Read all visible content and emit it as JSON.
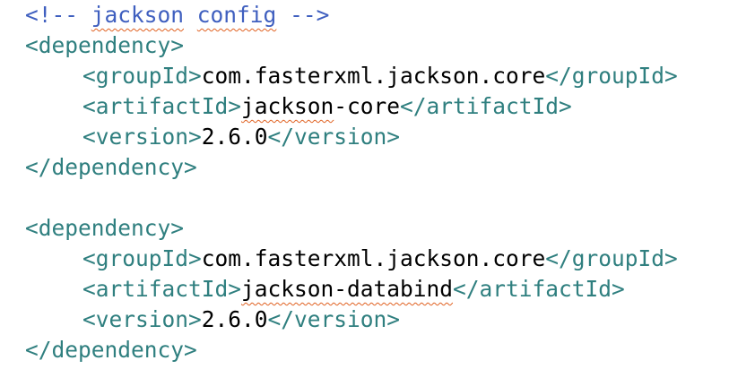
{
  "comment": {
    "open": "<!-- ",
    "word1": "jackson",
    "space": " ",
    "word2": "config",
    "close": " -->"
  },
  "dependencies": [
    {
      "open_tag": "<dependency>",
      "group_open": "<groupId>",
      "group_value": "com.fasterxml.jackson.core",
      "group_close": "</groupId>",
      "artifact_open": "<artifactId>",
      "artifact_value_a": "jackson",
      "artifact_value_b": "-core",
      "artifact_close": "</artifactId>",
      "version_open": "<version>",
      "version_value": "2.6.0",
      "version_close": "</version>",
      "close_tag": "</dependency>"
    },
    {
      "open_tag": "<dependency>",
      "group_open": "<groupId>",
      "group_value": "com.fasterxml.jackson.core",
      "group_close": "</groupId>",
      "artifact_open": "<artifactId>",
      "artifact_value_a": "jackson-databind",
      "artifact_value_b": "",
      "artifact_close": "</artifactId>",
      "version_open": "<version>",
      "version_value": "2.6.0",
      "version_close": "</version>",
      "close_tag": "</dependency>"
    }
  ],
  "colors": {
    "tag": "#2f7f7f",
    "comment": "#3f5fbf",
    "text": "#000000",
    "spellcheck": "#e06020"
  }
}
